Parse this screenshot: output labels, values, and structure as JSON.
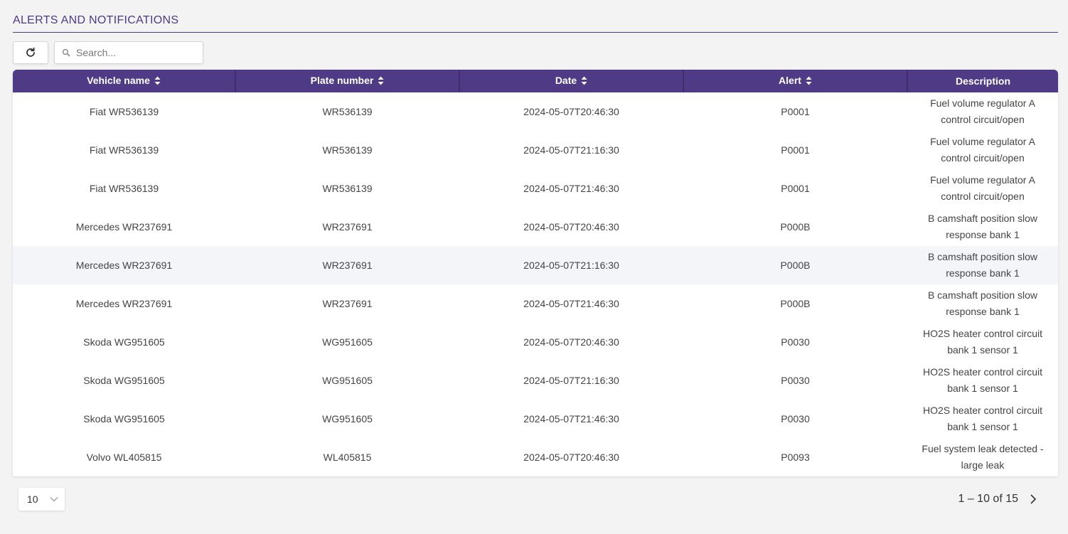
{
  "header": {
    "title": "ALERTS AND NOTIFICATIONS"
  },
  "toolbar": {
    "search_placeholder": "Search..."
  },
  "table": {
    "columns": [
      {
        "label": "Vehicle name",
        "sortable": true
      },
      {
        "label": "Plate number",
        "sortable": true
      },
      {
        "label": "Date",
        "sortable": true
      },
      {
        "label": "Alert",
        "sortable": true
      },
      {
        "label": "Description",
        "sortable": false
      }
    ],
    "rows": [
      {
        "vehicle": "Fiat WR536139",
        "plate": "WR536139",
        "date": "2024-05-07T20:46:30",
        "alert": "P0001",
        "description": "Fuel volume regulator A control circuit/open"
      },
      {
        "vehicle": "Fiat WR536139",
        "plate": "WR536139",
        "date": "2024-05-07T21:16:30",
        "alert": "P0001",
        "description": "Fuel volume regulator A control circuit/open"
      },
      {
        "vehicle": "Fiat WR536139",
        "plate": "WR536139",
        "date": "2024-05-07T21:46:30",
        "alert": "P0001",
        "description": "Fuel volume regulator A control circuit/open"
      },
      {
        "vehicle": "Mercedes WR237691",
        "plate": "WR237691",
        "date": "2024-05-07T20:46:30",
        "alert": "P000B",
        "description": "B camshaft position slow response bank 1"
      },
      {
        "vehicle": "Mercedes WR237691",
        "plate": "WR237691",
        "date": "2024-05-07T21:16:30",
        "alert": "P000B",
        "description": "B camshaft position slow response bank 1"
      },
      {
        "vehicle": "Mercedes WR237691",
        "plate": "WR237691",
        "date": "2024-05-07T21:46:30",
        "alert": "P000B",
        "description": "B camshaft position slow response bank 1"
      },
      {
        "vehicle": "Skoda WG951605",
        "plate": "WG951605",
        "date": "2024-05-07T20:46:30",
        "alert": "P0030",
        "description": "HO2S heater control circuit bank 1 sensor 1"
      },
      {
        "vehicle": "Skoda WG951605",
        "plate": "WG951605",
        "date": "2024-05-07T21:16:30",
        "alert": "P0030",
        "description": "HO2S heater control circuit bank 1 sensor 1"
      },
      {
        "vehicle": "Skoda WG951605",
        "plate": "WG951605",
        "date": "2024-05-07T21:46:30",
        "alert": "P0030",
        "description": "HO2S heater control circuit bank 1 sensor 1"
      },
      {
        "vehicle": "Volvo WL405815",
        "plate": "WL405815",
        "date": "2024-05-07T20:46:30",
        "alert": "P0093",
        "description": "Fuel system leak detected - large leak"
      }
    ],
    "highlighted_row": 4
  },
  "pagination": {
    "page_size": "10",
    "range_label": "1 – 10 of 15"
  },
  "icons": {
    "refresh": "refresh-icon",
    "search": "search-icon",
    "sort": "sort-icon",
    "chevron_down": "chevron-down-icon",
    "next": "chevron-right-icon"
  },
  "colors": {
    "accent": "#4e3a85",
    "row_highlight": "#f4f5f8"
  }
}
